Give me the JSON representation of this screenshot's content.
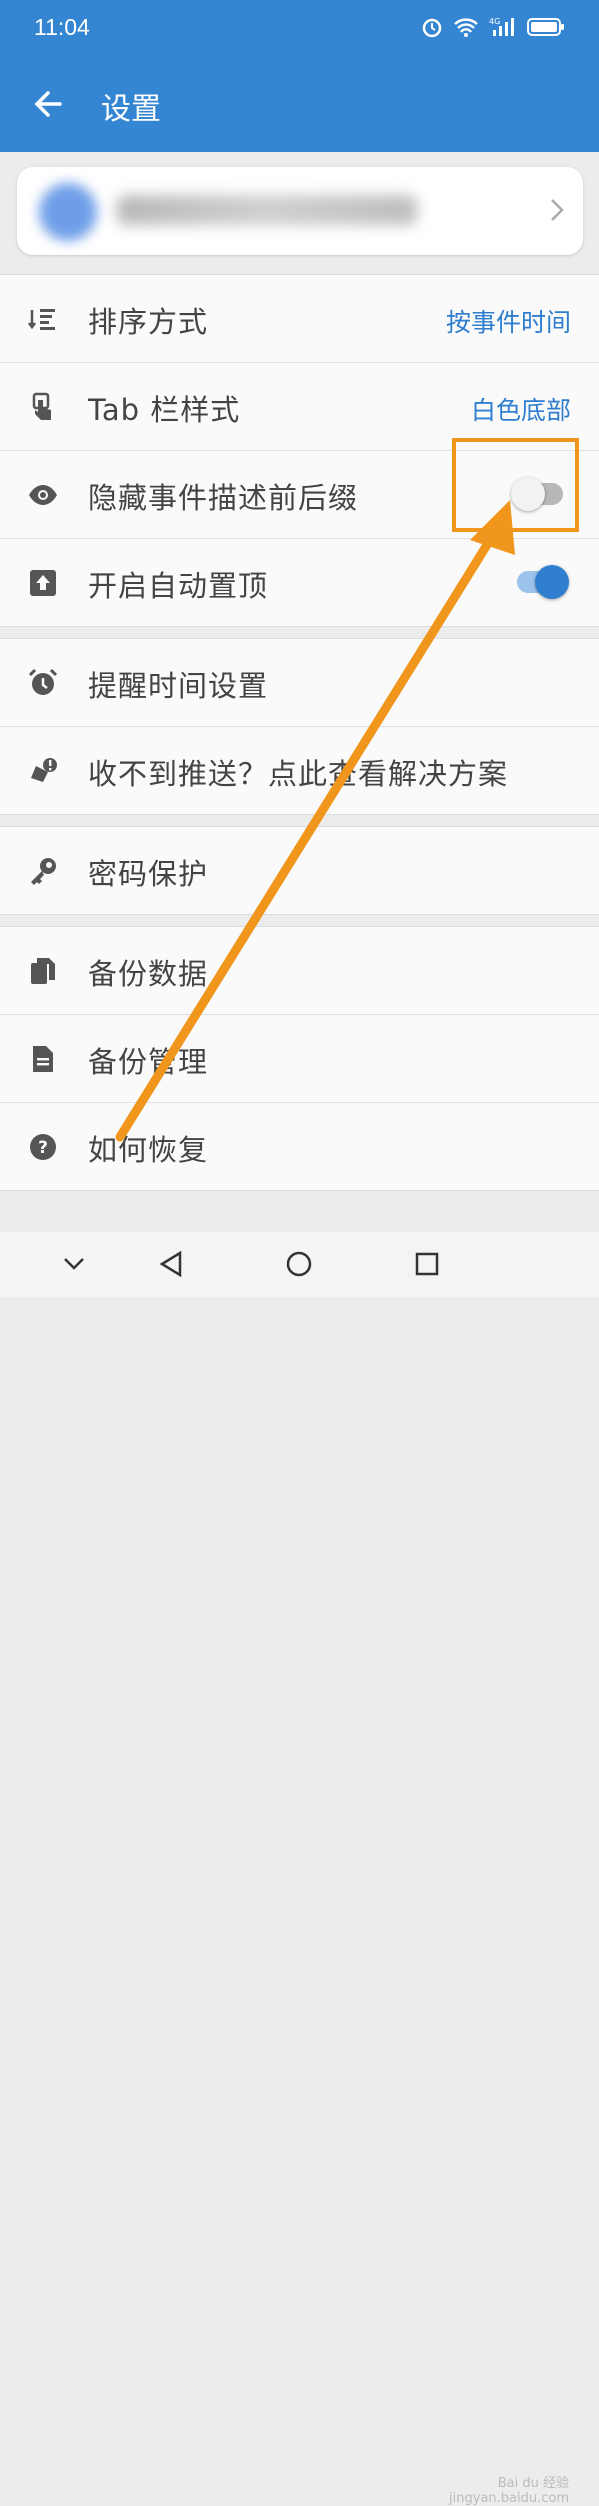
{
  "status_bar": {
    "time": "11:04"
  },
  "app_bar": {
    "title": "设置"
  },
  "settings_group_1": [
    {
      "label": "排序方式",
      "value": "按事件时间",
      "icon": "sort-icon"
    },
    {
      "label": "Tab 栏样式",
      "value": "白色底部",
      "icon": "touch-icon"
    },
    {
      "label": "隐藏事件描述前后缀",
      "toggle": false,
      "icon": "eye-icon"
    },
    {
      "label": "开启自动置顶",
      "toggle": true,
      "icon": "upload-icon"
    }
  ],
  "settings_group_2": [
    {
      "label": "提醒时间设置",
      "icon": "alarm-icon"
    },
    {
      "label": "收不到推送？点此查看解决方案",
      "icon": "bell-alert-icon"
    }
  ],
  "settings_group_3": [
    {
      "label": "密码保护",
      "icon": "key-icon"
    }
  ],
  "settings_group_4": [
    {
      "label": "备份数据",
      "icon": "copy-icon"
    },
    {
      "label": "备份管理",
      "icon": "file-icon"
    },
    {
      "label": "如何恢复",
      "icon": "help-icon"
    }
  ],
  "colors": {
    "primary": "#3586d2",
    "accent_value": "#2f7ed0",
    "annotation": "#f0961c"
  },
  "watermark": {
    "line1": "Bai du 经验",
    "line2": "jingyan.baidu.com"
  }
}
